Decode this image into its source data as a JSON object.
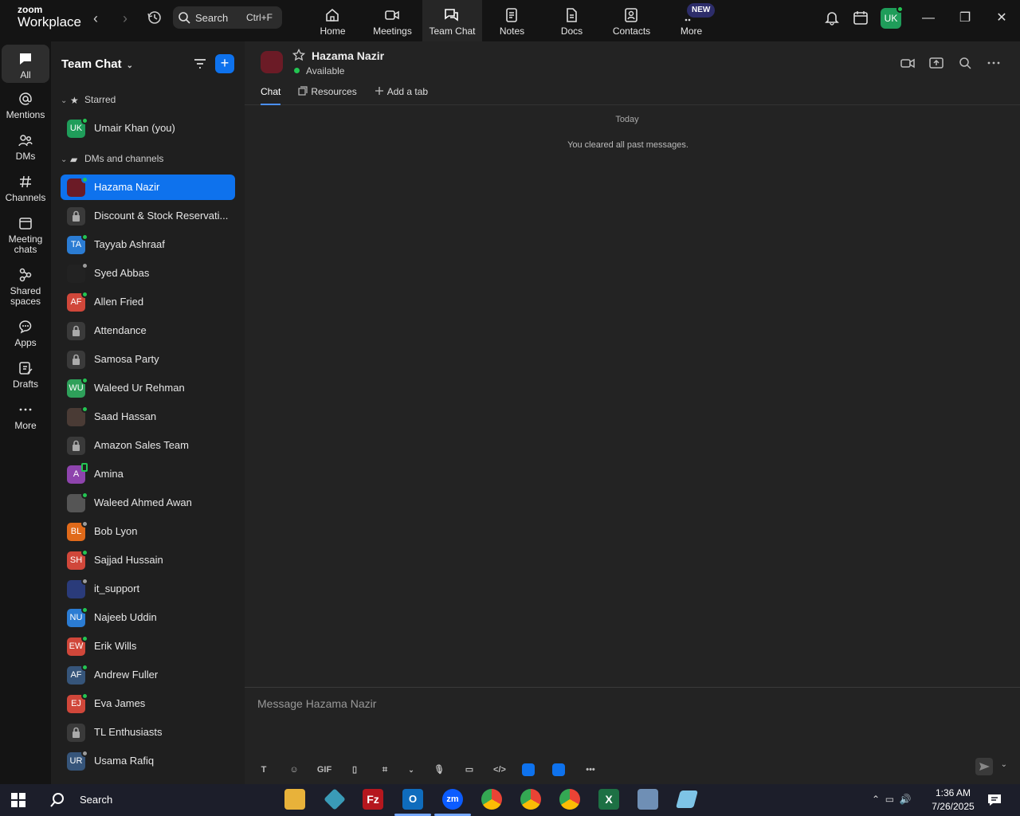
{
  "topbar": {
    "logo_top": "zoom",
    "logo_bottom": "Workplace",
    "search_label": "Search",
    "search_shortcut": "Ctrl+F",
    "nav": [
      {
        "label": "Home"
      },
      {
        "label": "Meetings"
      },
      {
        "label": "Team Chat"
      },
      {
        "label": "Notes"
      },
      {
        "label": "Docs"
      },
      {
        "label": "Contacts"
      },
      {
        "label": "More"
      }
    ],
    "new_badge": "NEW",
    "user_initials": "UK"
  },
  "rail": {
    "items": [
      {
        "label": "All"
      },
      {
        "label": "Mentions"
      },
      {
        "label": "DMs"
      },
      {
        "label": "Channels"
      },
      {
        "label": "Meeting chats"
      },
      {
        "label": "Shared spaces"
      },
      {
        "label": "Apps"
      },
      {
        "label": "Drafts"
      },
      {
        "label": "More"
      }
    ]
  },
  "list": {
    "title": "Team Chat",
    "starred_label": "Starred",
    "dms_label": "DMs and channels",
    "starred": [
      {
        "name": "Umair Khan (you)",
        "initials": "UK",
        "color": "#1f9d5a",
        "status": "online"
      }
    ],
    "rows": [
      {
        "name": "Hazama Nazir",
        "initials": "",
        "color": "#6b1b26",
        "status": "online"
      },
      {
        "name": "Discount & Stock Reservati...",
        "initials": "",
        "color": "lock",
        "status": "none"
      },
      {
        "name": "Tayyab Ashraaf",
        "initials": "TA",
        "color": "#2b7cd3",
        "status": "online"
      },
      {
        "name": "Syed Abbas",
        "initials": "",
        "color": "#222222",
        "status": "away"
      },
      {
        "name": "Allen Fried",
        "initials": "AF",
        "color": "#d0473a",
        "status": "online"
      },
      {
        "name": "Attendance",
        "initials": "",
        "color": "lock",
        "status": "none"
      },
      {
        "name": "Samosa Party",
        "initials": "",
        "color": "lock",
        "status": "none"
      },
      {
        "name": "Waleed Ur Rehman",
        "initials": "WU",
        "color": "#2ea05a",
        "status": "online"
      },
      {
        "name": "Saad Hassan",
        "initials": "",
        "color": "#4a3b35",
        "status": "online"
      },
      {
        "name": "Amazon Sales Team",
        "initials": "",
        "color": "lock",
        "status": "none"
      },
      {
        "name": "Amina",
        "initials": "A",
        "color": "#8e44ad",
        "status": "phone"
      },
      {
        "name": "Waleed Ahmed Awan",
        "initials": "",
        "color": "#555555",
        "status": "online"
      },
      {
        "name": "Bob Lyon",
        "initials": "BL",
        "color": "#e06a1a",
        "status": "away"
      },
      {
        "name": "Sajjad Hussain",
        "initials": "SH",
        "color": "#d0473a",
        "status": "online"
      },
      {
        "name": "it_support",
        "initials": "",
        "color": "#2a3b7a",
        "status": "away"
      },
      {
        "name": "Najeeb Uddin",
        "initials": "NU",
        "color": "#2b7cd3",
        "status": "online"
      },
      {
        "name": "Erik Wills",
        "initials": "EW",
        "color": "#d0473a",
        "status": "online"
      },
      {
        "name": "Andrew Fuller",
        "initials": "AF",
        "color": "#36557a",
        "status": "online"
      },
      {
        "name": "Eva James",
        "initials": "EJ",
        "color": "#d0473a",
        "status": "online"
      },
      {
        "name": "TL Enthusiasts",
        "initials": "",
        "color": "lock",
        "status": "none"
      },
      {
        "name": "Usama Rafiq",
        "initials": "UR",
        "color": "#36557a",
        "status": "away"
      }
    ]
  },
  "chat": {
    "contact_name": "Hazama Nazir",
    "contact_status": "Available",
    "tabs": [
      {
        "label": "Chat"
      },
      {
        "label": "Resources"
      },
      {
        "label": "Add a tab"
      }
    ],
    "date_separator": "Today",
    "system_message": "You cleared all past messages.",
    "composer_placeholder": "Message Hazama Nazir",
    "gif_label": "GIF"
  },
  "taskbar": {
    "search_label": "Search",
    "time": "1:36 AM",
    "date": "7/26/2025"
  },
  "colors": {
    "accent": "#0e72ed",
    "online": "#23c552"
  }
}
